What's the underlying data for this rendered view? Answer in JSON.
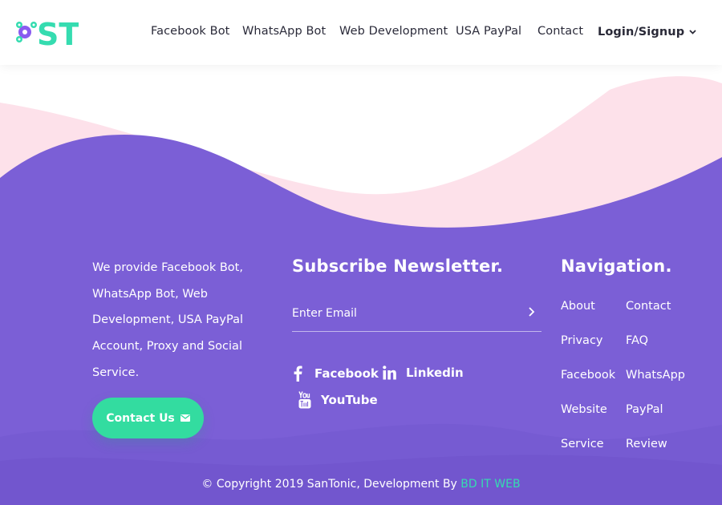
{
  "header": {
    "logo_text": "ST",
    "nav": [
      {
        "label": "Facebook Bot"
      },
      {
        "label": "WhatsApp Bot"
      },
      {
        "label": "Web Development"
      },
      {
        "label": "USA PayPal"
      },
      {
        "label": "Contact"
      }
    ],
    "login_label": "Login/Signup"
  },
  "footer": {
    "about_text": "We provide Facebook Bot, WhatsApp Bot, Web Development, USA PayPal Account, Proxy and Social Service.",
    "contact_button": "Contact Us",
    "newsletter": {
      "title": "Subscribe Newsletter.",
      "email_placeholder": "Enter Email"
    },
    "social": [
      {
        "label": "Facebook",
        "icon": "facebook-icon"
      },
      {
        "label": "Linkedin",
        "icon": "linkedin-icon"
      },
      {
        "label": "YouTube",
        "icon": "youtube-icon"
      }
    ],
    "navigation": {
      "title": "Navigation.",
      "col1": [
        "About",
        "Privacy",
        "Facebook",
        "Website",
        "Service"
      ],
      "col2": [
        "Contact",
        "FAQ",
        "WhatsApp",
        "PayPal",
        "Review"
      ]
    },
    "copyright_prefix": "© Copyright 2019 SanTonic, Development By ",
    "copyright_credit": "BD IT WEB"
  },
  "colors": {
    "purple": "#7b5fd6",
    "pink": "#fde1ea",
    "accent_green": "#33dca0",
    "logo_purple": "#8a5cf0",
    "logo_teal": "#35dcb0"
  }
}
